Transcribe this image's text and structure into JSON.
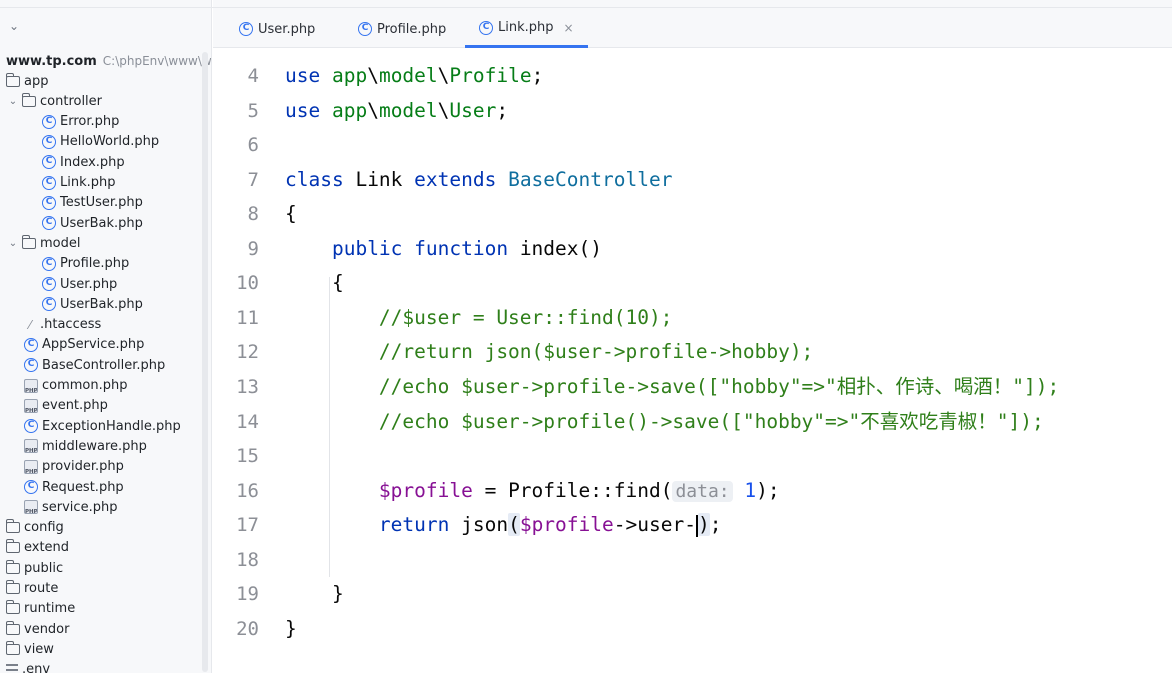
{
  "project": {
    "name": "www.tp.com",
    "path": "C:\\phpEnv\\www\\w",
    "tree": [
      {
        "label": "app",
        "icon": "folder-icon",
        "level": 0
      },
      {
        "label": "controller",
        "icon": "folder-icon",
        "level": 1,
        "expanded": true
      },
      {
        "label": "Error.php",
        "icon": "php-class-icon",
        "level": 2
      },
      {
        "label": "HelloWorld.php",
        "icon": "php-class-icon",
        "level": 2
      },
      {
        "label": "Index.php",
        "icon": "php-class-icon",
        "level": 2
      },
      {
        "label": "Link.php",
        "icon": "php-class-icon",
        "level": 2
      },
      {
        "label": "TestUser.php",
        "icon": "php-class-icon",
        "level": 2
      },
      {
        "label": "UserBak.php",
        "icon": "php-class-icon",
        "level": 2
      },
      {
        "label": "model",
        "icon": "folder-icon",
        "level": 1,
        "expanded": true
      },
      {
        "label": "Profile.php",
        "icon": "php-class-icon",
        "level": 2
      },
      {
        "label": "User.php",
        "icon": "php-class-icon",
        "level": 2
      },
      {
        "label": "UserBak.php",
        "icon": "php-class-icon",
        "level": 2
      },
      {
        "label": ".htaccess",
        "icon": "htaccess-icon",
        "level": 1
      },
      {
        "label": "AppService.php",
        "icon": "php-class-icon",
        "level": 1
      },
      {
        "label": "BaseController.php",
        "icon": "php-class-icon",
        "level": 1
      },
      {
        "label": "common.php",
        "icon": "php-file-icon",
        "level": 1
      },
      {
        "label": "event.php",
        "icon": "php-file-icon",
        "level": 1
      },
      {
        "label": "ExceptionHandle.php",
        "icon": "php-class-icon",
        "level": 1
      },
      {
        "label": "middleware.php",
        "icon": "php-file-icon",
        "level": 1
      },
      {
        "label": "provider.php",
        "icon": "php-file-icon",
        "level": 1
      },
      {
        "label": "Request.php",
        "icon": "php-class-icon",
        "level": 1
      },
      {
        "label": "service.php",
        "icon": "php-file-icon",
        "level": 1
      },
      {
        "label": "config",
        "icon": "folder-icon",
        "level": 0
      },
      {
        "label": "extend",
        "icon": "folder-icon",
        "level": 0
      },
      {
        "label": "public",
        "icon": "folder-icon",
        "level": 0
      },
      {
        "label": "route",
        "icon": "folder-icon",
        "level": 0
      },
      {
        "label": "runtime",
        "icon": "folder-icon",
        "level": 0
      },
      {
        "label": "vendor",
        "icon": "folder-icon",
        "level": 0
      },
      {
        "label": "view",
        "icon": "folder-icon",
        "level": 0
      },
      {
        "label": ".env",
        "icon": "text-file-icon",
        "level": 0
      }
    ]
  },
  "tabs": [
    {
      "label": "User.php",
      "active": false
    },
    {
      "label": "Profile.php",
      "active": false
    },
    {
      "label": "Link.php",
      "active": true,
      "close": "×"
    }
  ],
  "editor": {
    "lines": [
      {
        "n": "4",
        "tokens": [
          [
            "kw",
            "use "
          ],
          [
            "ns",
            "app"
          ],
          [
            "",
            "\\"
          ],
          [
            "ns",
            "model"
          ],
          [
            "",
            "\\"
          ],
          [
            "ns",
            "Profile"
          ],
          [
            "",
            ";"
          ]
        ]
      },
      {
        "n": "5",
        "tokens": [
          [
            "kw",
            "use "
          ],
          [
            "ns",
            "app"
          ],
          [
            "",
            "\\"
          ],
          [
            "ns",
            "model"
          ],
          [
            "",
            "\\"
          ],
          [
            "ns",
            "User"
          ],
          [
            "",
            ";"
          ]
        ]
      },
      {
        "n": "6",
        "tokens": []
      },
      {
        "n": "7",
        "tokens": [
          [
            "kw",
            "class "
          ],
          [
            "",
            "Link "
          ],
          [
            "kw",
            "extends "
          ],
          [
            "ty",
            "BaseController"
          ]
        ]
      },
      {
        "n": "8",
        "tokens": [
          [
            "",
            "{"
          ]
        ]
      },
      {
        "n": "9",
        "tokens": [
          [
            "",
            "    "
          ],
          [
            "kw",
            "public function "
          ],
          [
            "",
            "index()"
          ]
        ]
      },
      {
        "n": "10",
        "tokens": [
          [
            "",
            "    {"
          ]
        ]
      },
      {
        "n": "11",
        "tokens": [
          [
            "",
            "        "
          ],
          [
            "cmt",
            "//$user = User::find(10);"
          ]
        ]
      },
      {
        "n": "12",
        "tokens": [
          [
            "",
            "        "
          ],
          [
            "cmt",
            "//return json($user->profile->hobby);"
          ]
        ]
      },
      {
        "n": "13",
        "tokens": [
          [
            "",
            "        "
          ],
          [
            "cmt",
            "//echo $user->profile->save([\"hobby\"=>\"相扑、作诗、喝酒！\"]);"
          ]
        ]
      },
      {
        "n": "14",
        "tokens": [
          [
            "",
            "        "
          ],
          [
            "cmt",
            "//echo $user->profile()->save([\"hobby\"=>\"不喜欢吃青椒！\"]);"
          ]
        ]
      },
      {
        "n": "15",
        "tokens": []
      },
      {
        "n": "16",
        "tokens": [
          [
            "",
            "        "
          ],
          [
            "var",
            "$profile"
          ],
          [
            "",
            " = Profile::"
          ],
          [
            "",
            "find("
          ],
          [
            "hint",
            "data:"
          ],
          [
            "",
            " "
          ],
          [
            "num",
            "1"
          ],
          [
            "",
            ");"
          ]
        ]
      },
      {
        "n": "17",
        "tokens": [
          [
            "",
            "        "
          ],
          [
            "kw",
            "return "
          ],
          [
            "",
            "json"
          ],
          [
            "bh",
            "("
          ],
          [
            "var",
            "$profile"
          ],
          [
            "",
            "->user-"
          ],
          [
            "caret",
            ""
          ],
          [
            "bh",
            ")"
          ],
          [
            "",
            ";"
          ]
        ]
      },
      {
        "n": "18",
        "tokens": []
      },
      {
        "n": "19",
        "tokens": [
          [
            "",
            "    }"
          ]
        ]
      },
      {
        "n": "20",
        "tokens": [
          [
            "",
            "}"
          ]
        ]
      }
    ]
  },
  "colors": {
    "keyword": "#0033b3",
    "namespace": "#067d17",
    "comment": "#2f7f1a",
    "variable": "#871094",
    "number": "#1750eb",
    "accent": "#3574f0"
  }
}
